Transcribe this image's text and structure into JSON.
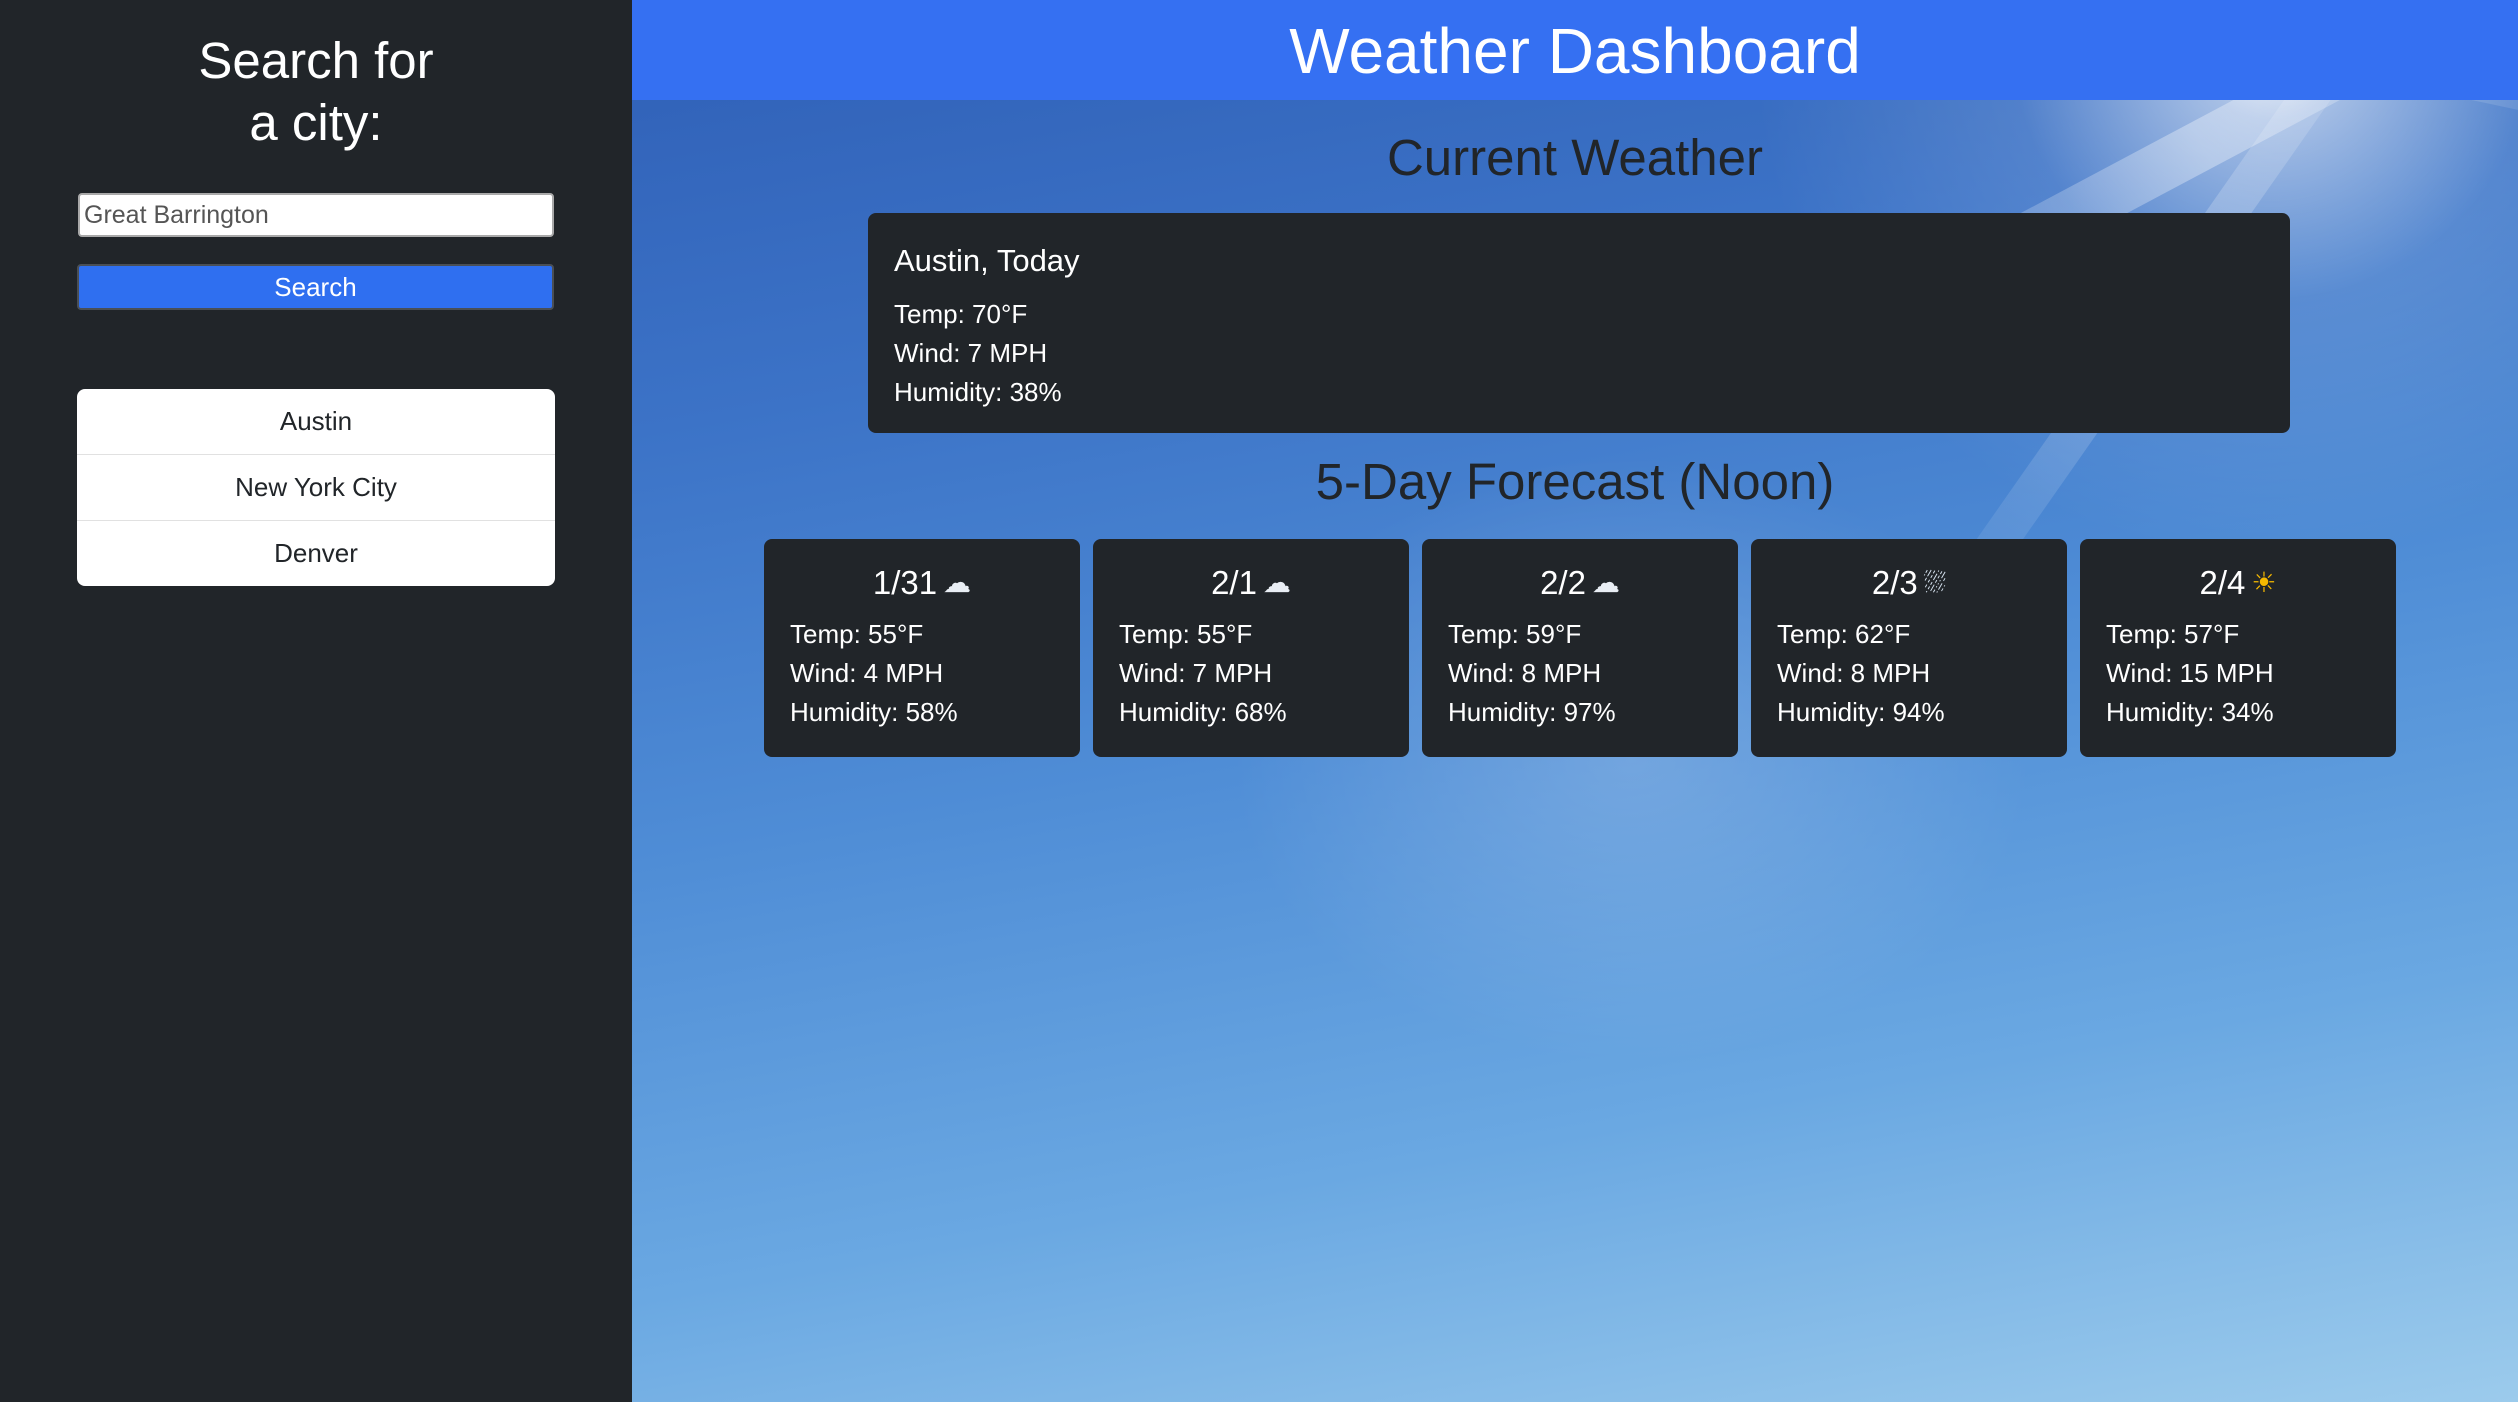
{
  "sidebar": {
    "title_line1": "Search for",
    "title_line2": "a city:",
    "search_value": "Great Barrington",
    "search_button_label": "Search",
    "cities": [
      "Austin",
      "New York City",
      "Denver"
    ]
  },
  "header": {
    "title": "Weather Dashboard"
  },
  "current": {
    "section_title": "Current Weather",
    "heading": "Austin, Today",
    "temp": "Temp: 70°F",
    "wind": "Wind: 7 MPH",
    "humidity": "Humidity: 38%"
  },
  "forecast": {
    "section_title": "5-Day Forecast (Noon)",
    "days": [
      {
        "date": "1/31",
        "icon": "cloud-icon",
        "glyph": "☁",
        "temp": "Temp: 55°F",
        "wind": "Wind: 4 MPH",
        "humidity": "Humidity: 58%"
      },
      {
        "date": "2/1",
        "icon": "cloud-icon",
        "glyph": "☁",
        "temp": "Temp: 55°F",
        "wind": "Wind: 7 MPH",
        "humidity": "Humidity: 68%"
      },
      {
        "date": "2/2",
        "icon": "cloud-icon",
        "glyph": "☁",
        "temp": "Temp: 59°F",
        "wind": "Wind: 8 MPH",
        "humidity": "Humidity: 97%"
      },
      {
        "date": "2/3",
        "icon": "rain-cloud-icon",
        "glyph": "⛆",
        "temp": "Temp: 62°F",
        "wind": "Wind: 8 MPH",
        "humidity": "Humidity: 94%"
      },
      {
        "date": "2/4",
        "icon": "sun-icon",
        "glyph": "☀",
        "temp": "Temp: 57°F",
        "wind": "Wind: 15 MPH",
        "humidity": "Humidity: 34%"
      }
    ]
  },
  "colors": {
    "sidebar_bg": "#212529",
    "accent_blue": "#3570f2",
    "card_bg": "#212529"
  }
}
